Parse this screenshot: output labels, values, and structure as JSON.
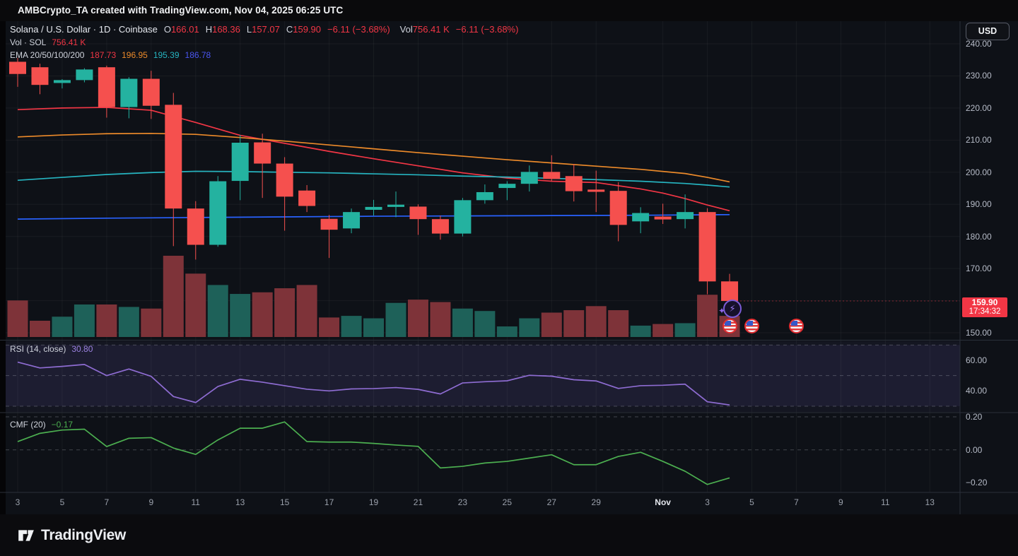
{
  "top_bar": {
    "watermark": "AMBCrypto_TA created with TradingView.com, Nov 04, 2025 06:25 UTC"
  },
  "legend": {
    "title": "Solana / U.S. Dollar · 1D · Coinbase",
    "o_label": "O",
    "o": "166.01",
    "h_label": "H",
    "h": "168.36",
    "l_label": "L",
    "l": "157.07",
    "c_label": "C",
    "c": "159.90",
    "change": "−6.11 (−3.68%)",
    "vol_label": "Vol",
    "vol_value": "756.41 K",
    "vol_change": "−6.11 (−3.68%)",
    "vol_row_label": "Vol · SOL",
    "vol_row_value": "756.41 K",
    "ema_label": "EMA 20/50/100/200",
    "ema_values": [
      {
        "text": "187.73",
        "color": "#f23645"
      },
      {
        "text": "196.95",
        "color": "#ec8a2a"
      },
      {
        "text": "195.39",
        "color": "#26b4c0"
      },
      {
        "text": "186.78",
        "color": "#4a55f0"
      }
    ]
  },
  "indicators": {
    "rsi_label": "RSI (14, close)",
    "rsi_value": "30.80",
    "cmf_label": "CMF (20)",
    "cmf_value": "−0.17"
  },
  "right_axis": {
    "currency_button": "USD",
    "price_badge": {
      "price": "159.90",
      "countdown": "17:34:32"
    },
    "price_ticks": [
      {
        "label": "240.00",
        "value": 240
      },
      {
        "label": "230.00",
        "value": 230
      },
      {
        "label": "220.00",
        "value": 220
      },
      {
        "label": "210.00",
        "value": 210
      },
      {
        "label": "200.00",
        "value": 200
      },
      {
        "label": "190.00",
        "value": 190
      },
      {
        "label": "180.00",
        "value": 180
      },
      {
        "label": "170.00",
        "value": 170
      },
      {
        "label": "150.00",
        "value": 150
      }
    ],
    "rsi_ticks": [
      {
        "label": "60.00",
        "value": 60
      },
      {
        "label": "40.00",
        "value": 40
      }
    ],
    "cmf_ticks": [
      {
        "label": "0.20",
        "value": 0.2
      },
      {
        "label": "0.00",
        "value": 0
      },
      {
        "label": "−0.20",
        "value": -0.2
      }
    ]
  },
  "time_axis": {
    "ticks": [
      {
        "label": "3",
        "day": 0
      },
      {
        "label": "5",
        "day": 2
      },
      {
        "label": "7",
        "day": 4
      },
      {
        "label": "9",
        "day": 6
      },
      {
        "label": "11",
        "day": 8
      },
      {
        "label": "13",
        "day": 10
      },
      {
        "label": "15",
        "day": 12
      },
      {
        "label": "17",
        "day": 14
      },
      {
        "label": "19",
        "day": 16
      },
      {
        "label": "21",
        "day": 18
      },
      {
        "label": "23",
        "day": 20
      },
      {
        "label": "25",
        "day": 22
      },
      {
        "label": "27",
        "day": 24
      },
      {
        "label": "29",
        "day": 26
      },
      {
        "label": "Nov",
        "day": 29,
        "emph": true
      },
      {
        "label": "3",
        "day": 31
      },
      {
        "label": "5",
        "day": 33
      },
      {
        "label": "7",
        "day": 35
      },
      {
        "label": "9",
        "day": 37
      },
      {
        "label": "11",
        "day": 39
      },
      {
        "label": "13",
        "day": 41
      }
    ]
  },
  "footer": {
    "brand": "TradingView"
  },
  "colors": {
    "bull": "#24b2a0",
    "bear": "#f5504e",
    "vol_bull": "#1e6159",
    "vol_bear": "#7e3339",
    "ema20": "#f23645",
    "ema50": "#ec8a2a",
    "ema100": "#26b4c0",
    "ema200": "#2962ff",
    "rsi_line": "#8e6cd2",
    "rsi_band": "rgba(126,98,208,0.09)",
    "rsi_pane_tint": "rgba(126,98,208,0.06)",
    "cmf_line": "#4caf50",
    "grid": "rgba(197,203,212,0.06)",
    "dashed_level": "rgba(200,205,215,0.5)",
    "separator": "#2a2f3a",
    "badge": "#f23645"
  },
  "chart_data": {
    "type": "candlestick",
    "title": "Solana / U.S. Dollar · 1D · Coinbase",
    "symbol": "SOL/USD",
    "interval": "1D",
    "exchange": "Coinbase",
    "last": {
      "open": 166.01,
      "high": 168.36,
      "low": 157.07,
      "close": 159.9,
      "change": -6.11,
      "change_pct": -3.68,
      "volume": "756.41 K"
    },
    "price_axis_range": [
      148,
      242
    ],
    "price_gridlines": [
      240,
      230,
      220,
      210,
      200,
      190,
      180,
      170,
      160,
      150
    ],
    "dates": [
      "Oct 3",
      "Oct 4",
      "Oct 5",
      "Oct 6",
      "Oct 7",
      "Oct 8",
      "Oct 9",
      "Oct 10",
      "Oct 11",
      "Oct 12",
      "Oct 13",
      "Oct 14",
      "Oct 15",
      "Oct 16",
      "Oct 17",
      "Oct 18",
      "Oct 19",
      "Oct 20",
      "Oct 21",
      "Oct 22",
      "Oct 23",
      "Oct 24",
      "Oct 25",
      "Oct 26",
      "Oct 27",
      "Oct 28",
      "Oct 29",
      "Oct 30",
      "Oct 31",
      "Nov 1",
      "Nov 2",
      "Nov 3",
      "Nov 4"
    ],
    "candles": [
      {
        "o": 234.4,
        "h": 235.6,
        "l": 226.6,
        "c": 230.6,
        "v": 0.45
      },
      {
        "o": 232.7,
        "h": 233.8,
        "l": 224.3,
        "c": 227.2,
        "v": 0.2
      },
      {
        "o": 227.8,
        "h": 229.0,
        "l": 226.1,
        "c": 228.7,
        "v": 0.25
      },
      {
        "o": 228.7,
        "h": 232.4,
        "l": 228.0,
        "c": 232.0,
        "v": 0.4
      },
      {
        "o": 232.7,
        "h": 233.2,
        "l": 217.0,
        "c": 220.3,
        "v": 0.4
      },
      {
        "o": 220.3,
        "h": 229.6,
        "l": 216.8,
        "c": 229.1,
        "v": 0.37
      },
      {
        "o": 229.1,
        "h": 231.6,
        "l": 216.6,
        "c": 220.7,
        "v": 0.35
      },
      {
        "o": 221.0,
        "h": 224.7,
        "l": 177.0,
        "c": 188.7,
        "v": 1.0
      },
      {
        "o": 188.7,
        "h": 191.0,
        "l": 172.8,
        "c": 177.4,
        "v": 0.78
      },
      {
        "o": 177.4,
        "h": 198.8,
        "l": 176.8,
        "c": 197.2,
        "v": 0.64
      },
      {
        "o": 197.3,
        "h": 211.6,
        "l": 191.3,
        "c": 209.2,
        "v": 0.53
      },
      {
        "o": 209.3,
        "h": 212.0,
        "l": 192.0,
        "c": 202.7,
        "v": 0.55
      },
      {
        "o": 202.7,
        "h": 204.7,
        "l": 181.8,
        "c": 192.4,
        "v": 0.6
      },
      {
        "o": 194.3,
        "h": 196.0,
        "l": 187.6,
        "c": 189.5,
        "v": 0.64
      },
      {
        "o": 185.5,
        "h": 186.7,
        "l": 173.3,
        "c": 182.1,
        "v": 0.24
      },
      {
        "o": 182.5,
        "h": 188.7,
        "l": 181.0,
        "c": 187.6,
        "v": 0.26
      },
      {
        "o": 188.3,
        "h": 191.4,
        "l": 186.5,
        "c": 189.2,
        "v": 0.23
      },
      {
        "o": 189.2,
        "h": 194.0,
        "l": 186.0,
        "c": 189.9,
        "v": 0.42
      },
      {
        "o": 189.3,
        "h": 190.0,
        "l": 180.5,
        "c": 185.4,
        "v": 0.46
      },
      {
        "o": 185.4,
        "h": 186.5,
        "l": 179.0,
        "c": 180.9,
        "v": 0.43
      },
      {
        "o": 180.9,
        "h": 192.0,
        "l": 180.0,
        "c": 191.3,
        "v": 0.35
      },
      {
        "o": 191.3,
        "h": 196.2,
        "l": 190.2,
        "c": 193.8,
        "v": 0.32
      },
      {
        "o": 195.1,
        "h": 197.2,
        "l": 191.3,
        "c": 196.4,
        "v": 0.13
      },
      {
        "o": 196.4,
        "h": 202.1,
        "l": 194.0,
        "c": 200.1,
        "v": 0.23
      },
      {
        "o": 200.1,
        "h": 205.3,
        "l": 197.1,
        "c": 197.9,
        "v": 0.3
      },
      {
        "o": 198.8,
        "h": 202.6,
        "l": 190.9,
        "c": 194.1,
        "v": 0.33
      },
      {
        "o": 194.6,
        "h": 200.5,
        "l": 187.6,
        "c": 193.9,
        "v": 0.38
      },
      {
        "o": 194.2,
        "h": 196.9,
        "l": 178.5,
        "c": 183.6,
        "v": 0.33
      },
      {
        "o": 184.7,
        "h": 189.1,
        "l": 181.0,
        "c": 187.3,
        "v": 0.14
      },
      {
        "o": 186.2,
        "h": 190.2,
        "l": 183.9,
        "c": 185.3,
        "v": 0.16
      },
      {
        "o": 185.4,
        "h": 193.1,
        "l": 182.5,
        "c": 187.6,
        "v": 0.17
      },
      {
        "o": 187.6,
        "h": 188.8,
        "l": 162.0,
        "c": 166.0,
        "v": 0.52
      },
      {
        "o": 166.01,
        "h": 168.36,
        "l": 157.07,
        "c": 159.9,
        "v": 0.26
      }
    ],
    "ema": [
      {
        "name": "EMA 20",
        "color": "#f23645",
        "points": [
          [
            0,
            219.5
          ],
          [
            2,
            220.0
          ],
          [
            4,
            220.2
          ],
          [
            6,
            219.3
          ],
          [
            8,
            215.5
          ],
          [
            10,
            211.5
          ],
          [
            12,
            209.0
          ],
          [
            14,
            206.5
          ],
          [
            16,
            204.2
          ],
          [
            18,
            202.0
          ],
          [
            20,
            199.8
          ],
          [
            22,
            198.2
          ],
          [
            24,
            197.2
          ],
          [
            26,
            196.8
          ],
          [
            28,
            194.8
          ],
          [
            29,
            193.5
          ],
          [
            30,
            191.8
          ],
          [
            31,
            189.8
          ],
          [
            32,
            188.0
          ]
        ]
      },
      {
        "name": "EMA 50",
        "color": "#ec8a2a",
        "points": [
          [
            0,
            211.0
          ],
          [
            2,
            211.6
          ],
          [
            4,
            212.0
          ],
          [
            6,
            212.1
          ],
          [
            8,
            211.8
          ],
          [
            10,
            210.8
          ],
          [
            12,
            209.7
          ],
          [
            14,
            208.5
          ],
          [
            16,
            207.3
          ],
          [
            18,
            206.1
          ],
          [
            20,
            205.0
          ],
          [
            22,
            203.9
          ],
          [
            24,
            202.9
          ],
          [
            26,
            201.9
          ],
          [
            28,
            200.9
          ],
          [
            30,
            199.6
          ],
          [
            31,
            198.4
          ],
          [
            32,
            197.0
          ]
        ]
      },
      {
        "name": "EMA 100",
        "color": "#26b4c0",
        "points": [
          [
            0,
            197.5
          ],
          [
            2,
            198.4
          ],
          [
            4,
            199.3
          ],
          [
            6,
            199.9
          ],
          [
            8,
            200.3
          ],
          [
            10,
            200.2
          ],
          [
            12,
            200.0
          ],
          [
            14,
            199.8
          ],
          [
            16,
            199.5
          ],
          [
            18,
            199.2
          ],
          [
            20,
            198.8
          ],
          [
            22,
            198.5
          ],
          [
            24,
            198.1
          ],
          [
            26,
            197.7
          ],
          [
            28,
            197.2
          ],
          [
            30,
            196.5
          ],
          [
            31,
            196.0
          ],
          [
            32,
            195.4
          ]
        ]
      },
      {
        "name": "EMA 200",
        "color": "#2962ff",
        "points": [
          [
            0,
            185.4
          ],
          [
            4,
            185.7
          ],
          [
            8,
            185.9
          ],
          [
            12,
            186.1
          ],
          [
            16,
            186.3
          ],
          [
            20,
            186.4
          ],
          [
            24,
            186.5
          ],
          [
            28,
            186.6
          ],
          [
            30,
            186.7
          ],
          [
            32,
            186.8
          ]
        ]
      }
    ],
    "rsi": {
      "name": "RSI (14, close)",
      "current": 30.8,
      "levels": [
        70,
        50,
        30
      ],
      "axis_range": [
        25,
        75
      ],
      "values": [
        58.8,
        55.0,
        56.0,
        57.3,
        50.0,
        54.3,
        49.5,
        36.3,
        32.4,
        42.9,
        47.6,
        45.7,
        43.4,
        41.1,
        40.0,
        41.3,
        41.5,
        42.2,
        41.0,
        38.0,
        45.2,
        46.0,
        46.6,
        50.2,
        49.6,
        47.3,
        46.5,
        41.6,
        43.4,
        43.7,
        44.4,
        32.9,
        30.8
      ]
    },
    "cmf": {
      "name": "CMF (20)",
      "current": -0.17,
      "levels": [
        0.2,
        0.0
      ],
      "axis_range": [
        -0.27,
        0.22
      ],
      "values": [
        0.05,
        0.1,
        0.12,
        0.125,
        0.02,
        0.07,
        0.074,
        0.011,
        -0.028,
        0.06,
        0.131,
        0.131,
        0.169,
        0.05,
        0.047,
        0.047,
        0.039,
        0.029,
        0.021,
        -0.11,
        -0.1,
        -0.08,
        -0.07,
        -0.05,
        -0.03,
        -0.09,
        -0.09,
        -0.04,
        -0.015,
        -0.07,
        -0.13,
        -0.21,
        -0.17
      ]
    },
    "event_markers": {
      "flag_days": [
        32,
        33,
        35
      ],
      "lightning_day": 32
    }
  }
}
